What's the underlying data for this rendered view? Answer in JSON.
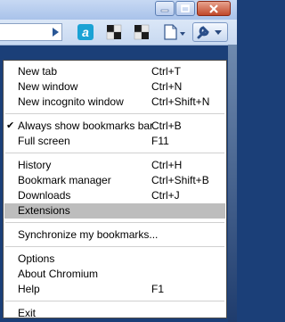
{
  "window": {
    "controls": [
      {
        "name": "minimize",
        "glyph": "▬"
      },
      {
        "name": "maximize",
        "glyph": "▢"
      },
      {
        "name": "close",
        "glyph": "✕"
      }
    ]
  },
  "toolbar": {
    "buttons": [
      "go-arrow-icon",
      "extension-a-icon",
      "extension-icon",
      "extension-icon",
      "page-menu-icon",
      "wrench-menu-icon"
    ],
    "accent": "#1aa2d4"
  },
  "menu": {
    "groups": [
      [
        {
          "label": "New tab",
          "shortcut": "Ctrl+T"
        },
        {
          "label": "New window",
          "shortcut": "Ctrl+N"
        },
        {
          "label": "New incognito window",
          "shortcut": "Ctrl+Shift+N"
        }
      ],
      [
        {
          "label": "Always show bookmarks bar",
          "shortcut": "Ctrl+B",
          "checked": true
        },
        {
          "label": "Full screen",
          "shortcut": "F11"
        }
      ],
      [
        {
          "label": "History",
          "shortcut": "Ctrl+H"
        },
        {
          "label": "Bookmark manager",
          "shortcut": "Ctrl+Shift+B"
        },
        {
          "label": "Downloads",
          "shortcut": "Ctrl+J"
        },
        {
          "label": "Extensions",
          "shortcut": "",
          "highlighted": true
        }
      ],
      [
        {
          "label": "Synchronize my bookmarks...",
          "shortcut": ""
        }
      ],
      [
        {
          "label": "Options",
          "shortcut": ""
        },
        {
          "label": "About Chromium",
          "shortcut": ""
        },
        {
          "label": "Help",
          "shortcut": "F1"
        }
      ],
      [
        {
          "label": "Exit",
          "shortcut": ""
        }
      ]
    ]
  }
}
